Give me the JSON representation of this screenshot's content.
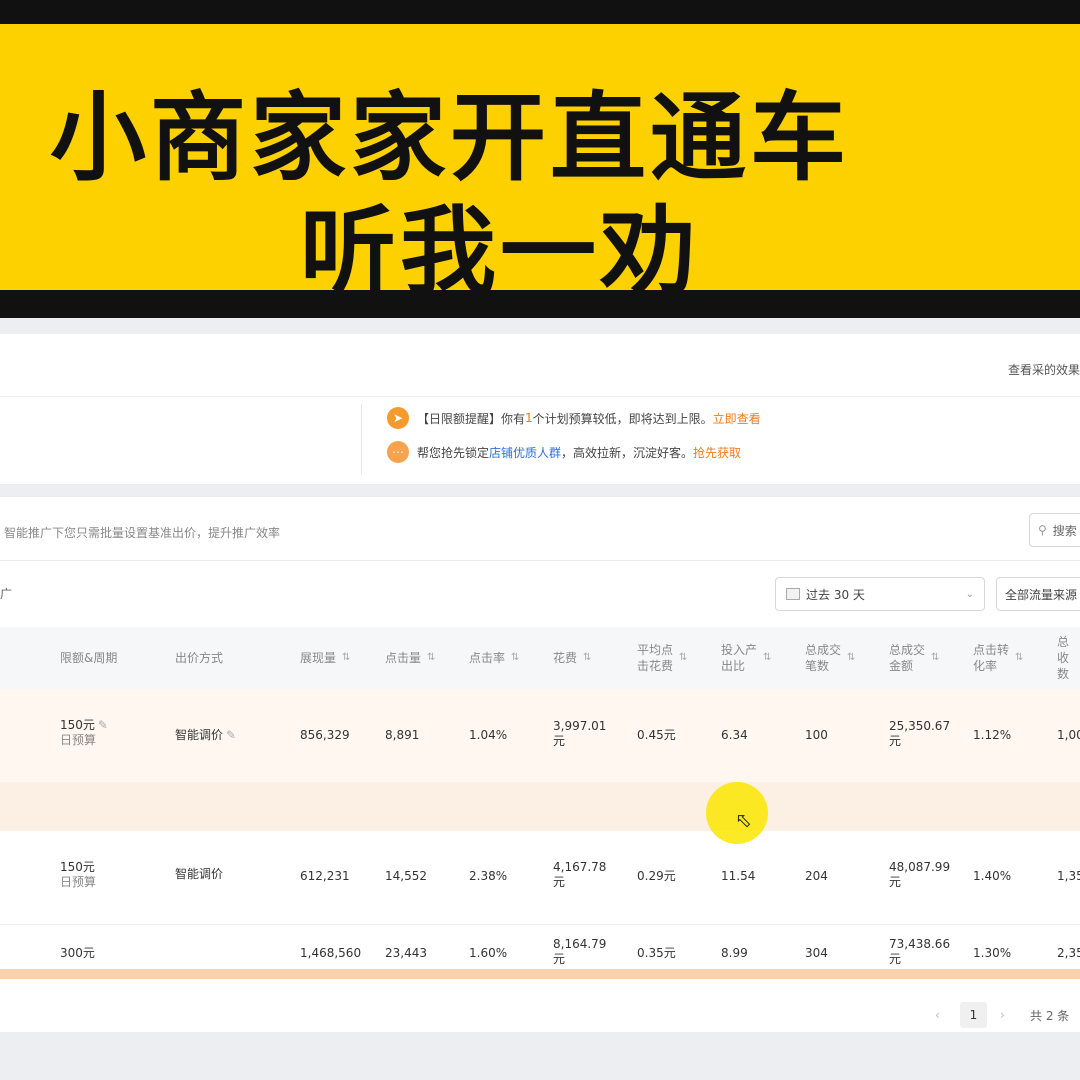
{
  "banner": {
    "line1": "小商家家开直通车",
    "line2": "听我一劝"
  },
  "top_card": {
    "view_link": "查看采的效果",
    "notices": [
      {
        "icon": "rocket-icon",
        "text1": "【日限额提醒】你有",
        "count": "1",
        "text2": "个计划预算较低，即将达到上限。",
        "action": "立即查看"
      },
      {
        "icon": "chat-bubble-icon",
        "text1": "帮您抢先锁定",
        "link": "店铺优质人群",
        "text2": "，高效拉新，沉淀好客。",
        "action": "抢先获取"
      }
    ]
  },
  "table_card": {
    "hint": "智能推广下您只需批量设置基准出价，提升推广效率",
    "search_label": "搜索",
    "fragment": "广",
    "date_range": "过去 30 天",
    "flow_source": "全部流量来源",
    "columns": {
      "budget": "限额&周期",
      "bid_mode": "出价方式",
      "impressions": "展现量",
      "clicks": "点击量",
      "ctr": "点击率",
      "cost": "花费",
      "avg_cpc_l1": "平均点",
      "avg_cpc_l2": "击花费",
      "roi_l1": "投入产",
      "roi_l2": "出比",
      "orders_l1": "总成交",
      "orders_l2": "笔数",
      "gmv_l1": "总成交",
      "gmv_l2": "金额",
      "cvr_l1": "点击转",
      "cvr_l2": "化率",
      "fav_l1": "总收",
      "fav_l2": "数"
    },
    "rows": [
      {
        "budget": "150元",
        "period": "日预算",
        "bid_mode": "智能调价",
        "impressions": "856,329",
        "clicks": "8,891",
        "ctr": "1.04%",
        "cost": "3,997.01",
        "cost_unit": "元",
        "avg_cpc": "0.45元",
        "roi": "6.34",
        "orders": "100",
        "gmv": "25,350.67",
        "gmv_unit": "元",
        "cvr": "1.12%",
        "fav": "1,00"
      },
      {
        "budget": "150元",
        "period": "日预算",
        "bid_mode": "智能调价",
        "impressions": "612,231",
        "clicks": "14,552",
        "ctr": "2.38%",
        "cost": "4,167.78",
        "cost_unit": "元",
        "avg_cpc": "0.29元",
        "roi": "11.54",
        "orders": "204",
        "gmv": "48,087.99",
        "gmv_unit": "元",
        "cvr": "1.40%",
        "fav": "1,35"
      },
      {
        "budget": "300元",
        "impressions": "1,468,560",
        "clicks": "23,443",
        "ctr": "1.60%",
        "cost": "8,164.79",
        "cost_unit": "元",
        "avg_cpc": "0.35元",
        "roi": "8.99",
        "orders": "304",
        "gmv": "73,438.66",
        "gmv_unit": "元",
        "cvr": "1.30%",
        "fav": "2,35"
      }
    ],
    "pagination": {
      "current_page": "1",
      "total": "共 2 条"
    }
  }
}
